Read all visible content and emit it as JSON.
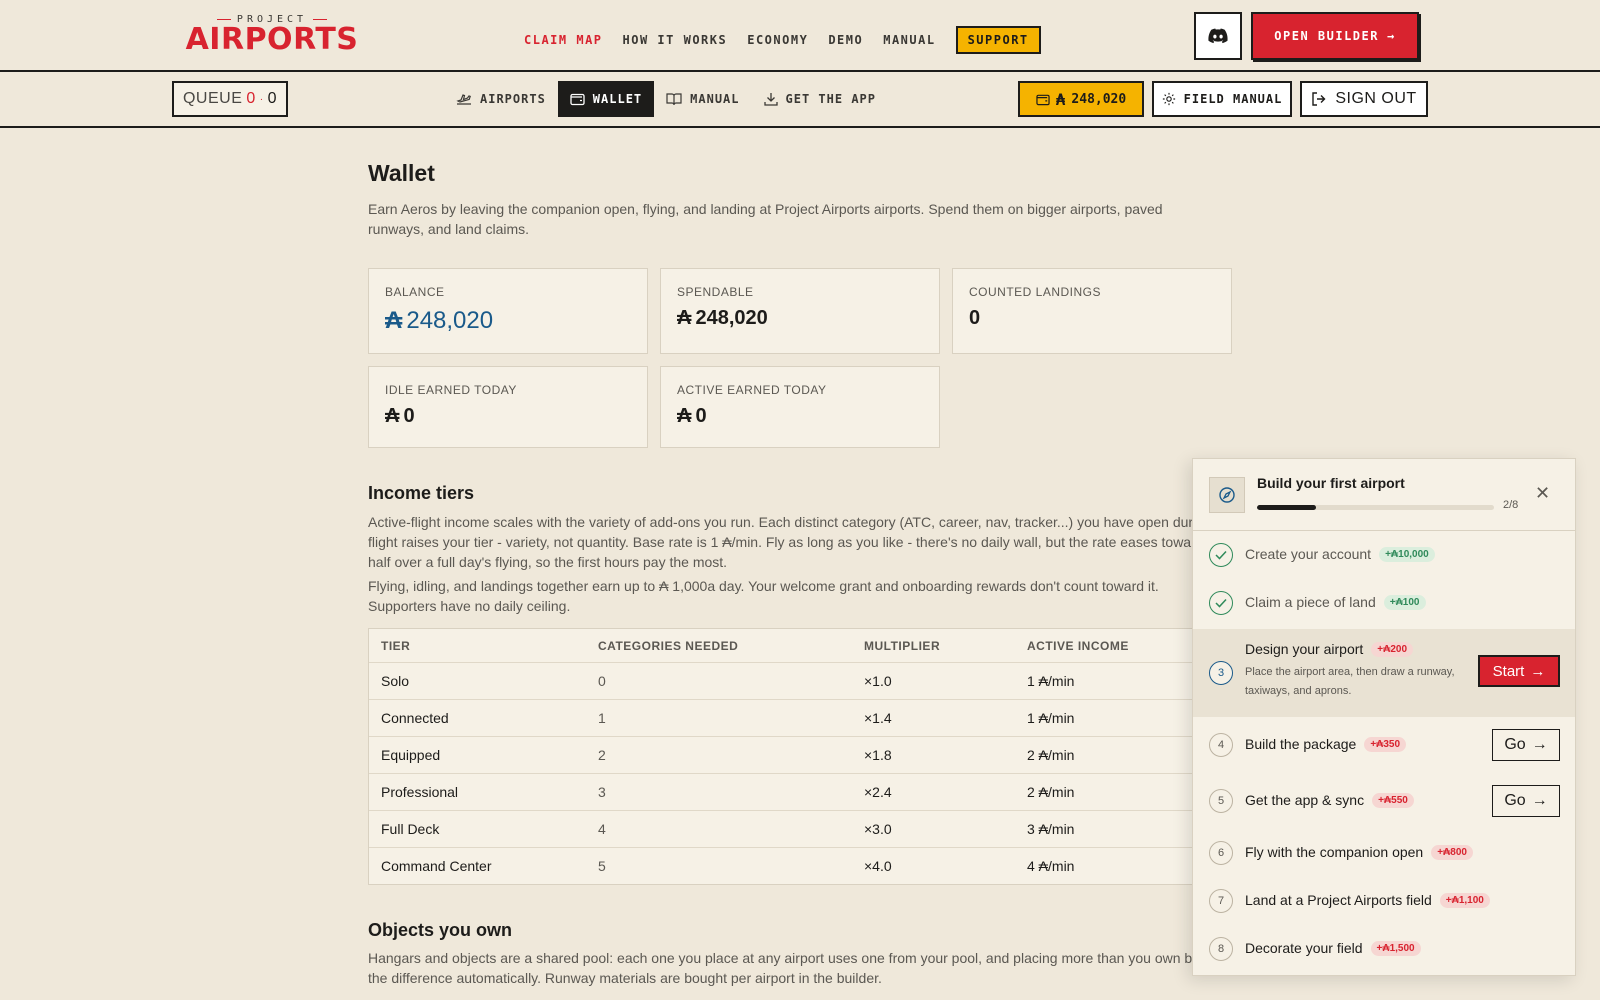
{
  "logo": {
    "top": "PROJECT",
    "main": "AIRPORTS"
  },
  "topnav": {
    "items": [
      "CLAIM MAP",
      "HOW IT WORKS",
      "ECONOMY",
      "DEMO",
      "MANUAL"
    ],
    "support": "SUPPORT",
    "open_builder": "OPEN BUILDER"
  },
  "subbar": {
    "queue_label": "QUEUE",
    "queue_red": "0",
    "queue_dot": "·",
    "queue_count": "0",
    "nav": [
      "AIRPORTS",
      "WALLET",
      "MANUAL",
      "GET THE APP"
    ],
    "balance_pill": "248,020",
    "field_manual": "FIELD MANUAL",
    "sign_out": "SIGN OUT"
  },
  "wallet": {
    "title": "Wallet",
    "description": "Earn Aeros by leaving the companion open, flying, and landing at Project Airports airports. Spend them on bigger airports, paved runways, and land claims.",
    "currency_symbol": "₳",
    "cards": [
      {
        "label": "BALANCE",
        "value": "248,020"
      },
      {
        "label": "SPENDABLE",
        "value": "248,020"
      },
      {
        "label": "COUNTED LANDINGS",
        "value": "0"
      },
      {
        "label": "IDLE EARNED TODAY",
        "value": "0"
      },
      {
        "label": "ACTIVE EARNED TODAY",
        "value": "0"
      }
    ]
  },
  "income": {
    "title": "Income tiers",
    "para1": "Active-flight income scales with the variety of add-ons you run. Each distinct category (ATC, career, nav, tracker...) you have open during flight raises your tier - variety, not quantity. Base rate is 1 ₳/min. Fly as long as you like - there's no daily wall, but the rate eases toward half over a full day's flying, so the first hours pay the most.",
    "para2": "Flying, idling, and landings together earn up to ₳ 1,000a day. Your welcome grant and onboarding rewards don't count toward it. Supporters have no daily ceiling.",
    "headers": [
      "TIER",
      "CATEGORIES NEEDED",
      "MULTIPLIER",
      "ACTIVE INCOME"
    ],
    "rows": [
      [
        "Solo",
        "0",
        "×1.0",
        "1 ₳/min"
      ],
      [
        "Connected",
        "1",
        "×1.4",
        "1 ₳/min"
      ],
      [
        "Equipped",
        "2",
        "×1.8",
        "2 ₳/min"
      ],
      [
        "Professional",
        "3",
        "×2.4",
        "2 ₳/min"
      ],
      [
        "Full Deck",
        "4",
        "×3.0",
        "3 ₳/min"
      ],
      [
        "Command Center",
        "5",
        "×4.0",
        "4 ₳/min"
      ]
    ]
  },
  "objects": {
    "title": "Objects you own",
    "para": "Hangars and objects are a shared pool: each one you place at any airport uses one from your pool, and placing more than you own buys the difference automatically. Runway materials are bought per airport in the builder."
  },
  "onboarding": {
    "title": "Build your first airport",
    "progress_text": "2/8",
    "progress_fraction": 0.25,
    "close": "✕",
    "start_label": "Start",
    "go_label": "Go",
    "steps": [
      {
        "num": "1",
        "title": "Create your account",
        "reward": "+₳10,000",
        "status": "done"
      },
      {
        "num": "2",
        "title": "Claim a piece of land",
        "reward": "+₳100",
        "status": "done"
      },
      {
        "num": "3",
        "title": "Design your airport",
        "reward": "+₳200",
        "status": "current",
        "desc": "Place the airport area, then draw a runway, taxiways, and aprons."
      },
      {
        "num": "4",
        "title": "Build the package",
        "reward": "+₳350",
        "status": "todo"
      },
      {
        "num": "5",
        "title": "Get the app & sync",
        "reward": "+₳550",
        "status": "todo"
      },
      {
        "num": "6",
        "title": "Fly with the companion open",
        "reward": "+₳800",
        "status": "todo"
      },
      {
        "num": "7",
        "title": "Land at a Project Airports field",
        "reward": "+₳1,100",
        "status": "todo"
      },
      {
        "num": "8",
        "title": "Decorate your field",
        "reward": "+₳1,500",
        "status": "todo"
      }
    ]
  },
  "colors": {
    "accent_red": "#d8232f",
    "accent_yellow": "#f5b300",
    "ink": "#1d1c1a",
    "background": "#efe8da",
    "balance_blue": "#1a5a8a"
  }
}
